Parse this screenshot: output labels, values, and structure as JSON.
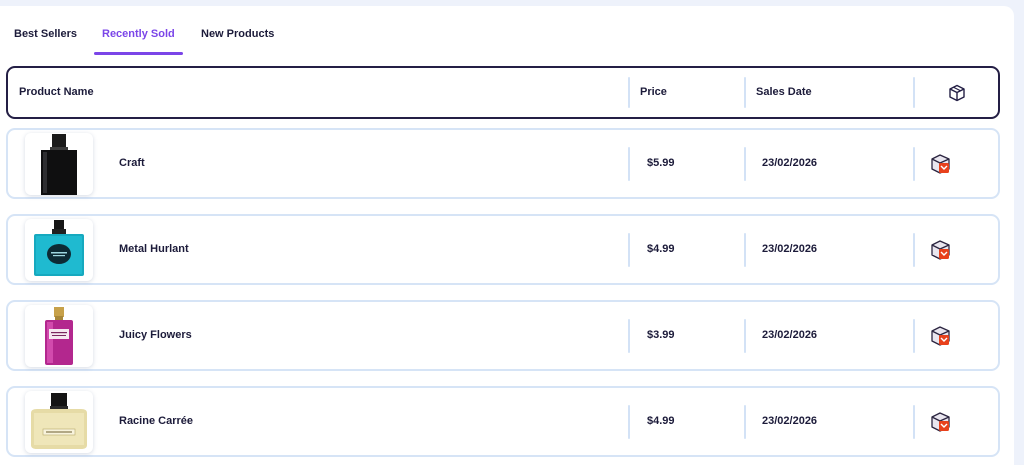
{
  "tabs": [
    {
      "label": "Best Sellers",
      "active": false
    },
    {
      "label": "Recently Sold",
      "active": true
    },
    {
      "label": "New Products",
      "active": false
    }
  ],
  "table": {
    "columns": {
      "product_name": "Product Name",
      "price": "Price",
      "sales_date": "Sales Date",
      "action_icon": "box-icon"
    },
    "rows": [
      {
        "name": "Craft",
        "price": "$5.99",
        "date": "23/02/2026",
        "image": "black-perfume-bottle"
      },
      {
        "name": "Metal Hurlant",
        "price": "$4.99",
        "date": "23/02/2026",
        "image": "teal-perfume-bottle"
      },
      {
        "name": "Juicy Flowers",
        "price": "$3.99",
        "date": "23/02/2026",
        "image": "magenta-perfume-bottle"
      },
      {
        "name": "Racine Carrée",
        "price": "$4.99",
        "date": "23/02/2026",
        "image": "gold-perfume-bottle"
      }
    ]
  },
  "colors": {
    "accent": "#7b45e8",
    "header_border": "#241f45",
    "row_border": "#d6e4f6",
    "action_icon": "#e8411c"
  }
}
